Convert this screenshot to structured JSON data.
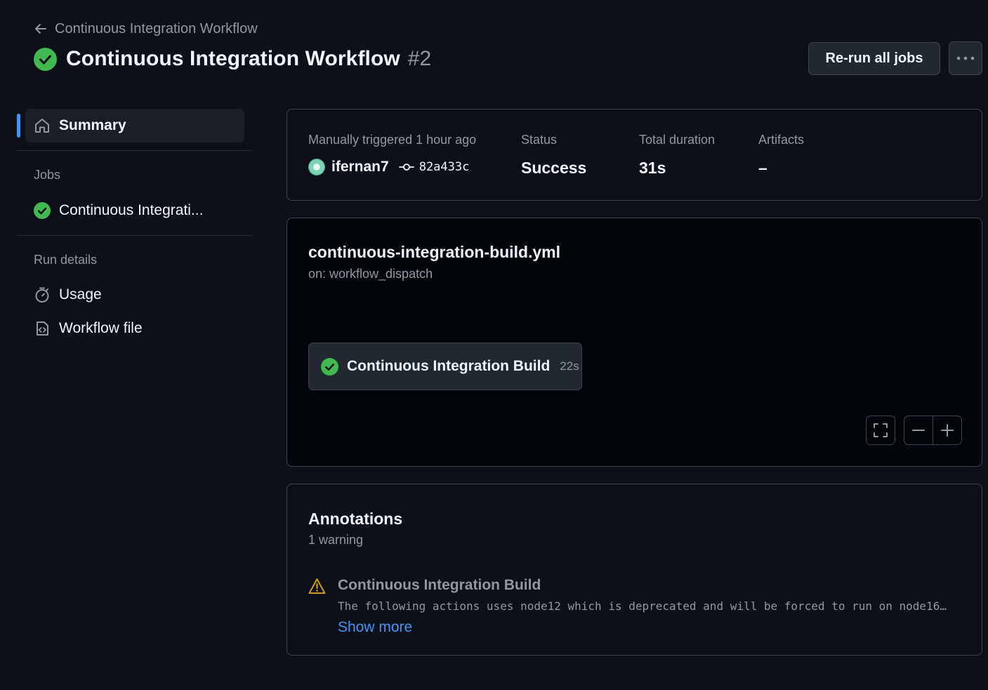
{
  "header": {
    "back_label": "Continuous Integration Workflow",
    "title": "Continuous Integration Workflow",
    "run_number": "#2",
    "rerun_label": "Re-run all jobs"
  },
  "sidebar": {
    "summary_label": "Summary",
    "jobs_heading": "Jobs",
    "jobs": [
      {
        "label": "Continuous Integrati..."
      }
    ],
    "run_details_heading": "Run details",
    "usage_label": "Usage",
    "workflow_file_label": "Workflow file"
  },
  "summary": {
    "trigger_label": "Manually triggered 1 hour ago",
    "actor": "ifernan7",
    "commit": "82a433c",
    "status_label": "Status",
    "status_value": "Success",
    "duration_label": "Total duration",
    "duration_value": "31s",
    "artifacts_label": "Artifacts",
    "artifacts_value": "–"
  },
  "graph": {
    "workflow_file": "continuous-integration-build.yml",
    "trigger": "on: workflow_dispatch",
    "job_name": "Continuous Integration Build",
    "job_duration": "22s"
  },
  "annotations": {
    "title": "Annotations",
    "count": "1 warning",
    "items": [
      {
        "job": "Continuous Integration Build",
        "message": "The following actions uses node12 which is deprecated and will be forced to run on node16…",
        "show_more": "Show more"
      }
    ]
  },
  "colors": {
    "background": "#0d1117",
    "success": "#3fb950",
    "warning": "#d29922",
    "link": "#4493f8",
    "accent": "#4493f8"
  }
}
